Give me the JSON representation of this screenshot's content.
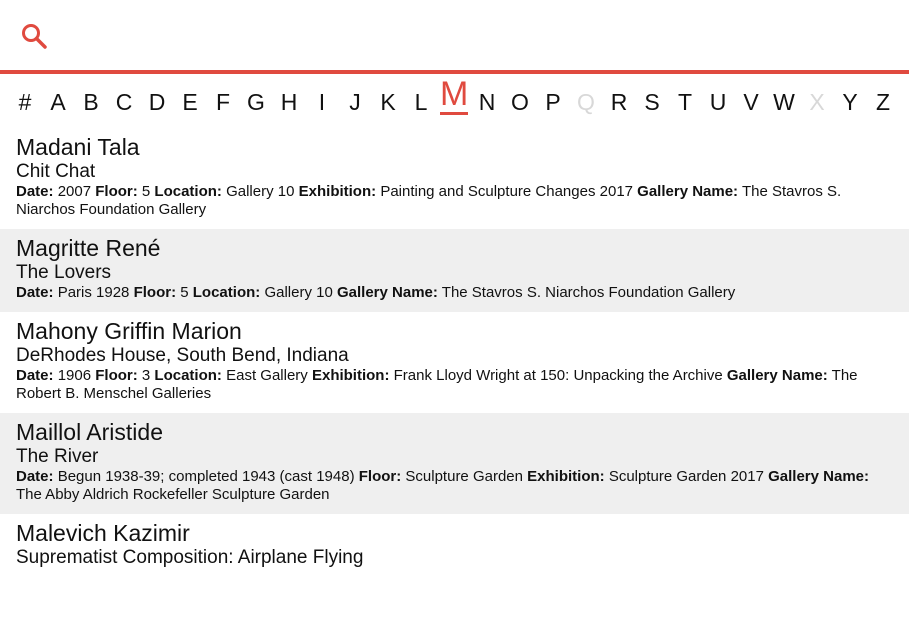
{
  "search": {
    "placeholder": ""
  },
  "colors": {
    "accent": "#e04a3f",
    "alt_row": "#efefef",
    "disabled": "#d8d8d8"
  },
  "alphabet": [
    {
      "label": "#",
      "state": "normal"
    },
    {
      "label": "A",
      "state": "normal"
    },
    {
      "label": "B",
      "state": "normal"
    },
    {
      "label": "C",
      "state": "normal"
    },
    {
      "label": "D",
      "state": "normal"
    },
    {
      "label": "E",
      "state": "normal"
    },
    {
      "label": "F",
      "state": "normal"
    },
    {
      "label": "G",
      "state": "normal"
    },
    {
      "label": "H",
      "state": "normal"
    },
    {
      "label": "I",
      "state": "normal"
    },
    {
      "label": "J",
      "state": "normal"
    },
    {
      "label": "K",
      "state": "normal"
    },
    {
      "label": "L",
      "state": "normal"
    },
    {
      "label": "M",
      "state": "active"
    },
    {
      "label": "N",
      "state": "normal"
    },
    {
      "label": "O",
      "state": "normal"
    },
    {
      "label": "P",
      "state": "normal"
    },
    {
      "label": "Q",
      "state": "disabled"
    },
    {
      "label": "R",
      "state": "normal"
    },
    {
      "label": "S",
      "state": "normal"
    },
    {
      "label": "T",
      "state": "normal"
    },
    {
      "label": "U",
      "state": "normal"
    },
    {
      "label": "V",
      "state": "normal"
    },
    {
      "label": "W",
      "state": "normal"
    },
    {
      "label": "X",
      "state": "disabled"
    },
    {
      "label": "Y",
      "state": "normal"
    },
    {
      "label": "Z",
      "state": "normal"
    }
  ],
  "entries": [
    {
      "artist": "Madani Tala",
      "title": "Chit Chat",
      "fields": [
        {
          "label": "Date:",
          "value": "2007"
        },
        {
          "label": "Floor:",
          "value": "5"
        },
        {
          "label": "Location:",
          "value": "Gallery 10"
        },
        {
          "label": "Exhibition:",
          "value": "Painting and Sculpture Changes 2017"
        },
        {
          "label": "Gallery Name:",
          "value": "The Stavros S. Niarchos Foundation Gallery"
        }
      ]
    },
    {
      "artist": "Magritte René",
      "title": "The Lovers",
      "fields": [
        {
          "label": "Date:",
          "value": "Paris 1928"
        },
        {
          "label": "Floor:",
          "value": "5"
        },
        {
          "label": "Location:",
          "value": "Gallery 10"
        },
        {
          "label": "Gallery Name:",
          "value": "The Stavros S. Niarchos Foundation Gallery"
        }
      ]
    },
    {
      "artist": "Mahony Griffin Marion",
      "title": "DeRhodes House, South Bend, Indiana",
      "fields": [
        {
          "label": "Date:",
          "value": "1906"
        },
        {
          "label": "Floor:",
          "value": "3"
        },
        {
          "label": "Location:",
          "value": "East Gallery"
        },
        {
          "label": "Exhibition:",
          "value": "Frank Lloyd Wright at 150: Unpacking the Archive"
        },
        {
          "label": "Gallery Name:",
          "value": "The Robert B. Menschel Galleries"
        }
      ]
    },
    {
      "artist": "Maillol Aristide",
      "title": "The River",
      "fields": [
        {
          "label": "Date:",
          "value": "Begun 1938-39; completed 1943 (cast 1948)"
        },
        {
          "label": "Floor:",
          "value": "Sculpture Garden"
        },
        {
          "label": "Exhibition:",
          "value": "Sculpture Garden 2017"
        },
        {
          "label": "Gallery Name:",
          "value": "The Abby Aldrich Rockefeller Sculpture Garden"
        }
      ]
    },
    {
      "artist": "Malevich Kazimir",
      "title": "Suprematist Composition: Airplane Flying",
      "fields": []
    }
  ]
}
